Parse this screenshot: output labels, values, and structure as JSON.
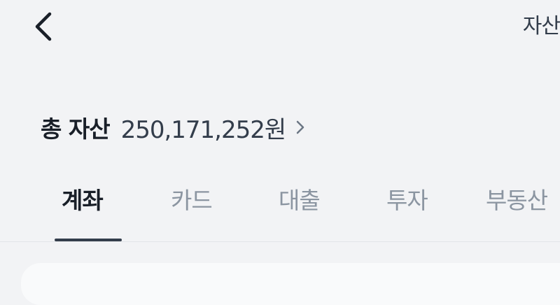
{
  "header": {
    "back_icon": "chevron-left-icon",
    "title": "자산"
  },
  "summary": {
    "label": "총 자산",
    "amount": "250,171,252원",
    "chevron_icon": "chevron-right-icon"
  },
  "tabs": [
    {
      "label": "계좌",
      "active": true
    },
    {
      "label": "카드",
      "active": false
    },
    {
      "label": "대출",
      "active": false
    },
    {
      "label": "투자",
      "active": false
    },
    {
      "label": "부동산",
      "active": false
    }
  ],
  "colors": {
    "background": "#f2f3f5",
    "text_primary": "#191f28",
    "text_secondary": "#333d4b",
    "text_inactive": "#8b95a1",
    "indicator": "#333d4b",
    "card": "#f9fafb"
  }
}
